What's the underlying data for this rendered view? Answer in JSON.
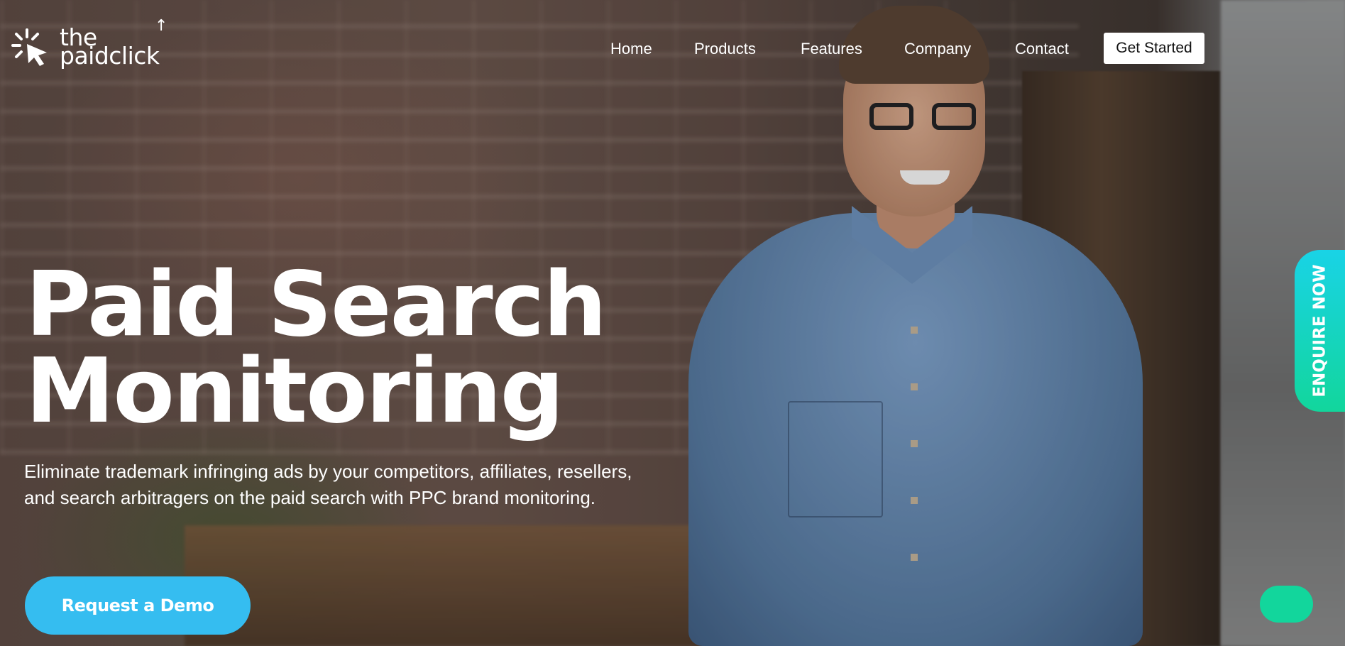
{
  "brand": {
    "line1": "the",
    "line2": "paidclick"
  },
  "nav": {
    "items": [
      "Home",
      "Products",
      "Features",
      "Company",
      "Contact"
    ],
    "cta": "Get Started"
  },
  "hero": {
    "headline_line1": "Paid Search",
    "headline_line2": "Monitoring",
    "subtext": "Eliminate trademark infringing ads by your competitors, affiliates, resellers, and search arbitragers on the paid search with PPC brand monitoring.",
    "demo_button": "Request a Demo"
  },
  "side_tab": {
    "label": "ENQUIRE NOW"
  },
  "colors": {
    "primary_blue": "#35bdf0",
    "accent_green": "#12d69c",
    "accent_cyan": "#19d3e6"
  },
  "icons": [
    "cursor-click-logo-icon",
    "chat-icon"
  ]
}
